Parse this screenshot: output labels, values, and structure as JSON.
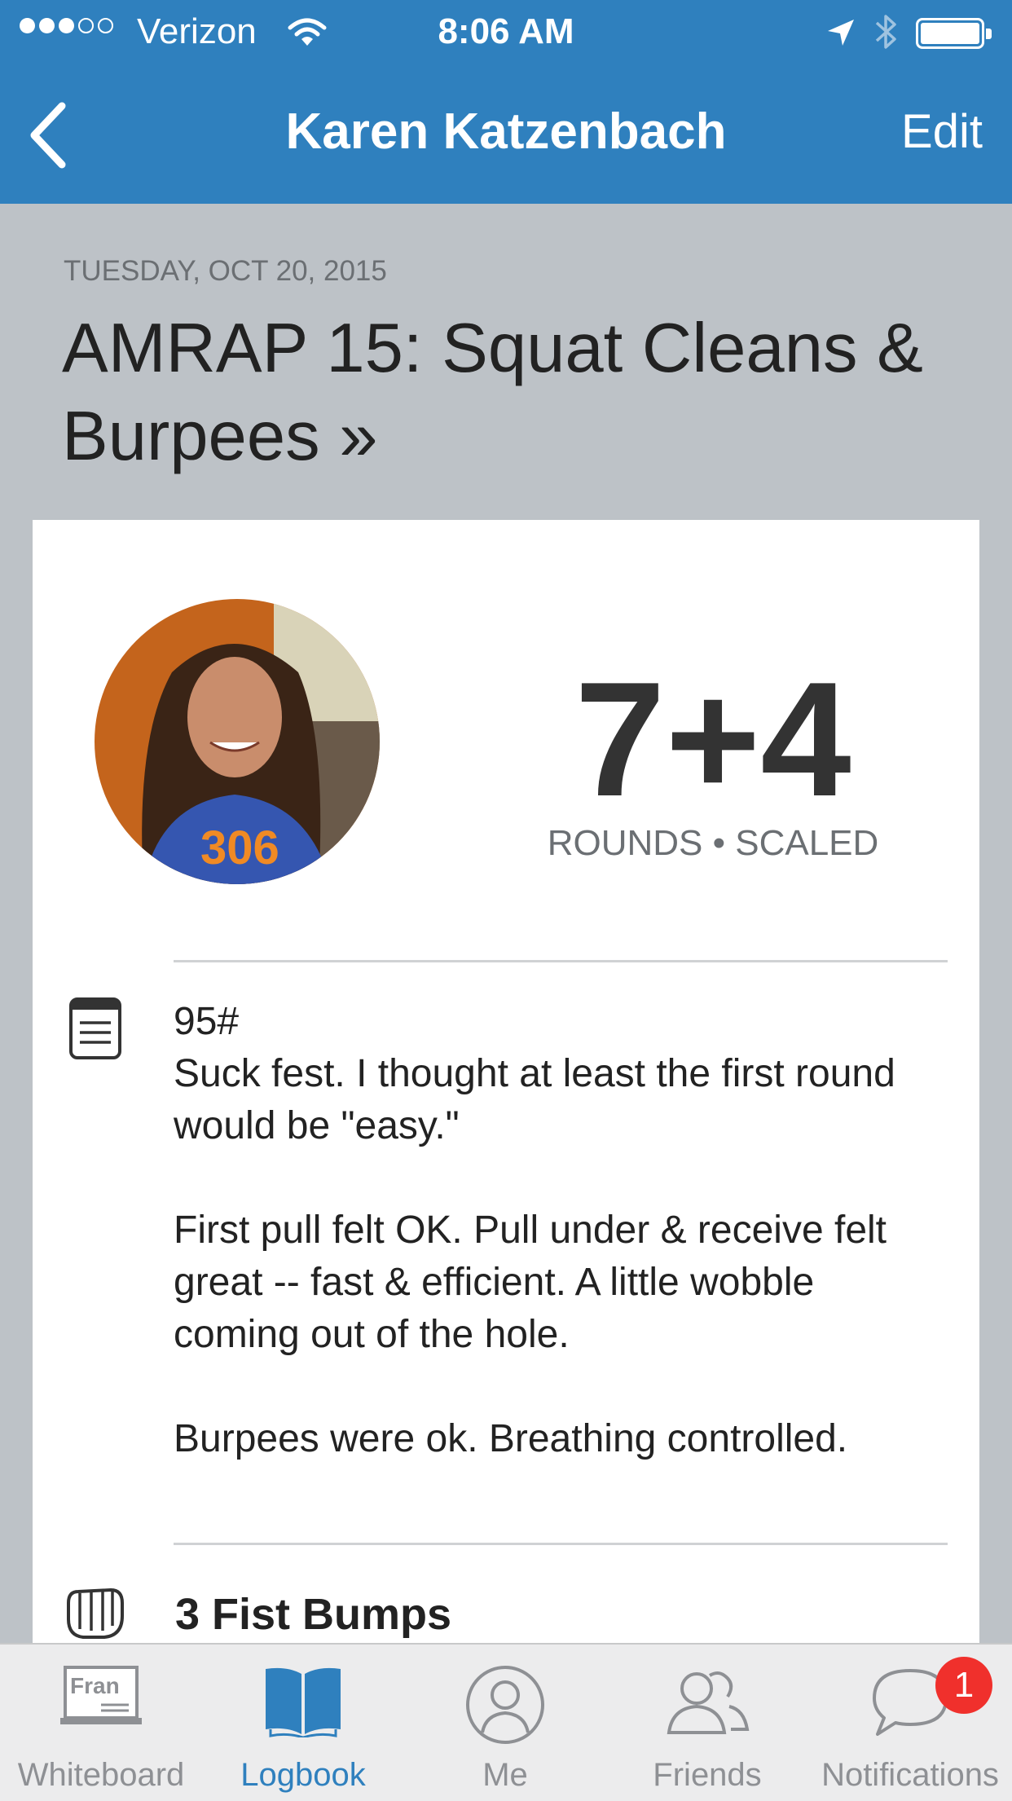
{
  "status": {
    "carrier": "Verizon",
    "time": "8:06 AM",
    "signal_bars": 3,
    "signal_total": 5,
    "battery_level": 1.0
  },
  "nav": {
    "back_icon": "chevron-left-icon",
    "title": "Karen Katzenbach",
    "edit": "Edit"
  },
  "workout": {
    "date": "TUESDAY, OCT 20, 2015",
    "title": "AMRAP 15: Squat Cleans & Burpees »"
  },
  "result": {
    "score": "7+4",
    "sub": "ROUNDS • SCALED",
    "notes": "95#\nSuck fest. I thought at least the first round would be \"easy.\"\n\nFirst pull felt OK. Pull under & receive felt great -- fast & efficient. A little wobble coming out of the hole.\n\nBurpees were ok. Breathing controlled.",
    "fist_bumps": "3 Fist Bumps"
  },
  "tabs": [
    {
      "label": "Whiteboard",
      "icon": "whiteboard-icon",
      "active": false
    },
    {
      "label": "Logbook",
      "icon": "book-icon",
      "active": true
    },
    {
      "label": "Me",
      "icon": "person-icon",
      "active": false
    },
    {
      "label": "Friends",
      "icon": "friends-icon",
      "active": false
    },
    {
      "label": "Notifications",
      "icon": "chat-bubble-icon",
      "active": false
    }
  ],
  "whiteboard_icon_text": "Fran",
  "notifications_badge": "1",
  "colors": {
    "nav_blue": "#2f80be",
    "page_bg": "#bdc2c7",
    "badge_red": "#f0302c",
    "tab_inactive": "#8e9094"
  }
}
